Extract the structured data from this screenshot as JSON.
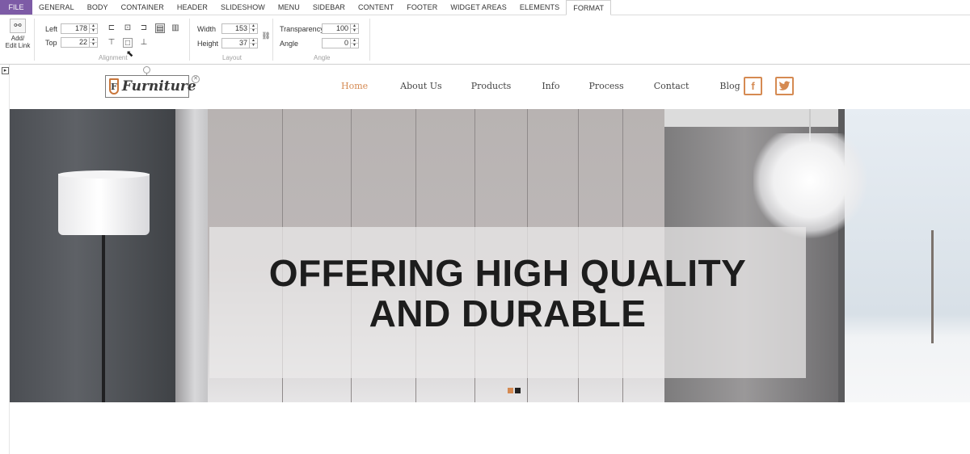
{
  "menubar": {
    "file": "FILE",
    "tabs": [
      "GENERAL",
      "BODY",
      "CONTAINER",
      "HEADER",
      "SLIDESHOW",
      "MENU",
      "SIDEBAR",
      "CONTENT",
      "FOOTER",
      "WIDGET AREAS",
      "ELEMENTS",
      "FORMAT"
    ],
    "active_tab": "FORMAT"
  },
  "ribbon": {
    "link_button": {
      "line1": "Add/",
      "line2": "Edit Link",
      "icon": "link-icon"
    },
    "alignment": {
      "caption": "Alignment",
      "left_label": "Left",
      "left_value": "178",
      "top_label": "Top",
      "top_value": "22",
      "icons": [
        "align-left-icon",
        "align-center-horizontal-icon",
        "align-right-icon",
        "align-top-icon",
        "align-middle-icon",
        "align-bottom-icon",
        "bring-forward-icon",
        "send-backward-icon"
      ]
    },
    "layout": {
      "caption": "Layout",
      "width_label": "Width",
      "width_value": "153",
      "height_label": "Height",
      "height_value": "37",
      "lock_icon": "chain-lock-icon"
    },
    "angle": {
      "caption": "Angle",
      "transparency_label": "Transparency",
      "transparency_value": "100",
      "angle_label": "Angle",
      "angle_value": "0"
    }
  },
  "site": {
    "logo_letter": "F",
    "logo_text": "Furniture",
    "nav": [
      "Home",
      "About Us",
      "Products",
      "Info",
      "Process",
      "Contact",
      "Blog"
    ],
    "nav_active": "Home",
    "social": [
      {
        "name": "facebook-icon",
        "glyph": "f"
      },
      {
        "name": "twitter-icon",
        "glyph": "🐦"
      }
    ],
    "hero": {
      "headline_line1": "OFFERING HIGH QUALITY",
      "headline_line2": "AND DURABLE",
      "slide_count": 2,
      "active_slide": 1
    }
  },
  "colors": {
    "file_tab": "#7d5ba6",
    "accent": "#d58a52",
    "headline": "#1d1d1d"
  }
}
